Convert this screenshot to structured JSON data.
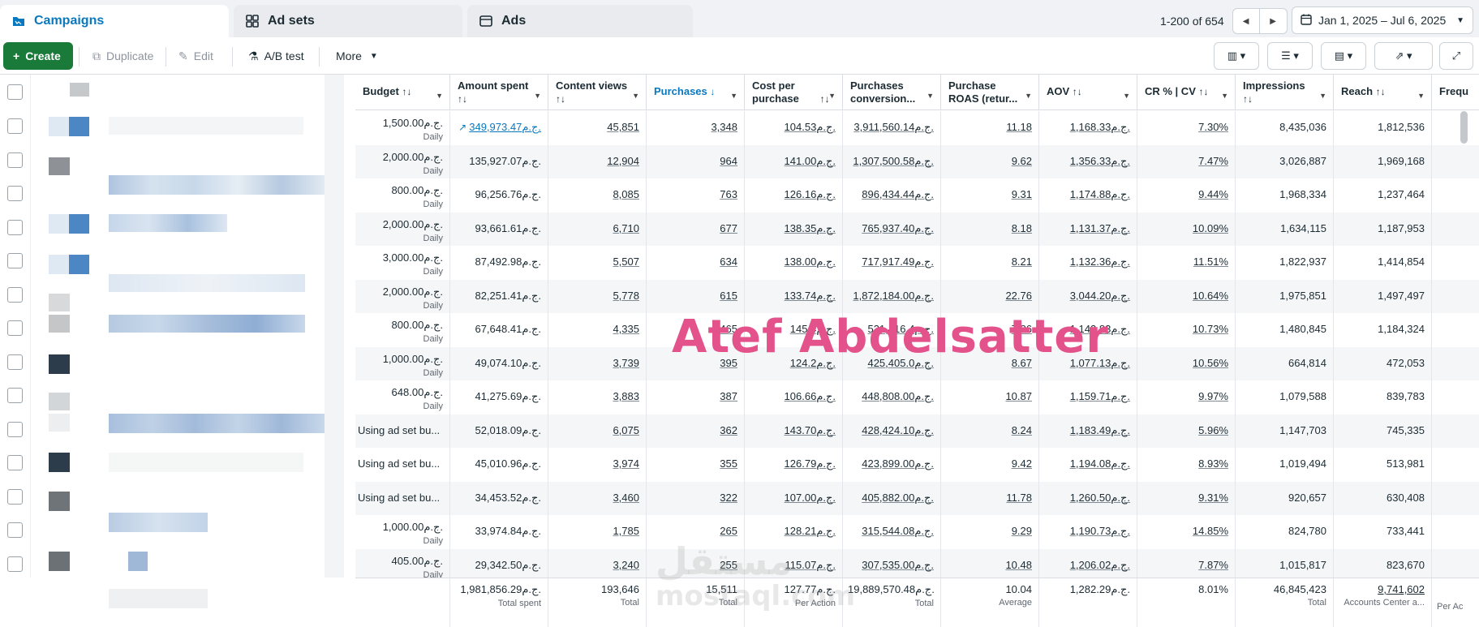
{
  "tabs": [
    {
      "label": "Campaigns",
      "icon": "folder-icon"
    },
    {
      "label": "Ad sets",
      "icon": "grid-icon"
    },
    {
      "label": "Ads",
      "icon": "ad-icon"
    }
  ],
  "pager": {
    "range": "1-200 of 654"
  },
  "date_range": "Jan 1, 2025 – Jul 6, 2025",
  "toolbar": {
    "create": "Create",
    "duplicate": "Duplicate",
    "edit": "Edit",
    "ab_test": "A/B test",
    "more": "More"
  },
  "columns": [
    {
      "label": "Budget",
      "sort": "↑↓"
    },
    {
      "label": "Amount spent",
      "sort": "↑↓"
    },
    {
      "label": "Content views",
      "sort": "↑↓"
    },
    {
      "label": "Purchases",
      "sort": "↓"
    },
    {
      "label": "Cost per purchase",
      "sort": "↑↓"
    },
    {
      "label": "Purchases conversion...",
      "sort": ""
    },
    {
      "label": "Purchase ROAS (retur...",
      "sort": ""
    },
    {
      "label": "AOV",
      "sort": "↑↓"
    },
    {
      "label": "CR % | CV",
      "sort": "↑↓"
    },
    {
      "label": "Impressions",
      "sort": "↑↓"
    },
    {
      "label": "Reach",
      "sort": "↑↓"
    },
    {
      "label": "Frequ",
      "sort": ""
    }
  ],
  "rows": [
    {
      "budget": "1,500.00ج.م.",
      "budget_sub": "Daily",
      "spent": "349,973.47ج.م.",
      "content_views": "45,851",
      "purchases": "3,348",
      "cpp": "104.53ج.م.",
      "conv_value": "3,911,560.14ج.م.",
      "roas": "11.18",
      "aov": "1,168.33ج.م.",
      "cr": "7.30%",
      "impressions": "8,435,036",
      "reach": "1,812,536"
    },
    {
      "budget": "2,000.00ج.م.",
      "budget_sub": "Daily",
      "spent": "135,927.07ج.م.",
      "content_views": "12,904",
      "purchases": "964",
      "cpp": "141.00ج.م.",
      "conv_value": "1,307,500.58ج.م.",
      "roas": "9.62",
      "aov": "1,356.33ج.م.",
      "cr": "7.47%",
      "impressions": "3,026,887",
      "reach": "1,969,168"
    },
    {
      "budget": "800.00ج.م.",
      "budget_sub": "Daily",
      "spent": "96,256.76ج.م.",
      "content_views": "8,085",
      "purchases": "763",
      "cpp": "126.16ج.م.",
      "conv_value": "896,434.44ج.م.",
      "roas": "9.31",
      "aov": "1,174.88ج.م.",
      "cr": "9.44%",
      "impressions": "1,968,334",
      "reach": "1,237,464"
    },
    {
      "budget": "2,000.00ج.م.",
      "budget_sub": "Daily",
      "spent": "93,661.61ج.م.",
      "content_views": "6,710",
      "purchases": "677",
      "cpp": "138.35ج.م.",
      "conv_value": "765,937.40ج.م.",
      "roas": "8.18",
      "aov": "1,131.37ج.م.",
      "cr": "10.09%",
      "impressions": "1,634,115",
      "reach": "1,187,953"
    },
    {
      "budget": "3,000.00ج.م.",
      "budget_sub": "Daily",
      "spent": "87,492.98ج.م.",
      "content_views": "5,507",
      "purchases": "634",
      "cpp": "138.00ج.م.",
      "conv_value": "717,917.49ج.م.",
      "roas": "8.21",
      "aov": "1,132.36ج.م.",
      "cr": "11.51%",
      "impressions": "1,822,937",
      "reach": "1,414,854"
    },
    {
      "budget": "2,000.00ج.م.",
      "budget_sub": "Daily",
      "spent": "82,251.41ج.م.",
      "content_views": "5,778",
      "purchases": "615",
      "cpp": "133.74ج.م.",
      "conv_value": "1,872,184.00ج.م.",
      "roas": "22.76",
      "aov": "3,044.20ج.م.",
      "cr": "10.64%",
      "impressions": "1,975,851",
      "reach": "1,497,497"
    },
    {
      "budget": "800.00ج.م.",
      "budget_sub": "Daily",
      "spent": "67,648.41ج.م.",
      "content_views": "4,335",
      "purchases": "465",
      "cpp": "145.4ج.م.",
      "conv_value": "531,416.4ج.م.",
      "roas": "7.86",
      "aov": "1,142.83ج.م.",
      "cr": "10.73%",
      "impressions": "1,480,845",
      "reach": "1,184,324"
    },
    {
      "budget": "1,000.00ج.م.",
      "budget_sub": "Daily",
      "spent": "49,074.10ج.م.",
      "content_views": "3,739",
      "purchases": "395",
      "cpp": "124.2ج.م.",
      "conv_value": "425,405.0ج.م.",
      "roas": "8.67",
      "aov": "1,077.13ج.م.",
      "cr": "10.56%",
      "impressions": "664,814",
      "reach": "472,053"
    },
    {
      "budget": "648.00ج.م.",
      "budget_sub": "Daily",
      "spent": "41,275.69ج.م.",
      "content_views": "3,883",
      "purchases": "387",
      "cpp": "106.66ج.م.",
      "conv_value": "448,808.00ج.م.",
      "roas": "10.87",
      "aov": "1,159.71ج.م.",
      "cr": "9.97%",
      "impressions": "1,079,588",
      "reach": "839,783"
    },
    {
      "budget": "Using ad set bu...",
      "budget_sub": "",
      "spent": "52,018.09ج.م.",
      "content_views": "6,075",
      "purchases": "362",
      "cpp": "143.70ج.م.",
      "conv_value": "428,424.10ج.م.",
      "roas": "8.24",
      "aov": "1,183.49ج.م.",
      "cr": "5.96%",
      "impressions": "1,147,703",
      "reach": "745,335"
    },
    {
      "budget": "Using ad set bu...",
      "budget_sub": "",
      "spent": "45,010.96ج.م.",
      "content_views": "3,974",
      "purchases": "355",
      "cpp": "126.79ج.م.",
      "conv_value": "423,899.00ج.م.",
      "roas": "9.42",
      "aov": "1,194.08ج.م.",
      "cr": "8.93%",
      "impressions": "1,019,494",
      "reach": "513,981"
    },
    {
      "budget": "Using ad set bu...",
      "budget_sub": "",
      "spent": "34,453.52ج.م.",
      "content_views": "3,460",
      "purchases": "322",
      "cpp": "107.00ج.م.",
      "conv_value": "405,882.00ج.م.",
      "roas": "11.78",
      "aov": "1,260.50ج.م.",
      "cr": "9.31%",
      "impressions": "920,657",
      "reach": "630,408"
    },
    {
      "budget": "1,000.00ج.م.",
      "budget_sub": "Daily",
      "spent": "33,974.84ج.م.",
      "content_views": "1,785",
      "purchases": "265",
      "cpp": "128.21ج.م.",
      "conv_value": "315,544.08ج.م.",
      "roas": "9.29",
      "aov": "1,190.73ج.م.",
      "cr": "14.85%",
      "impressions": "824,780",
      "reach": "733,441"
    },
    {
      "budget": "405.00ج.م.",
      "budget_sub": "Daily",
      "spent": "29,342.50ج.م.",
      "content_views": "3,240",
      "purchases": "255",
      "cpp": "115.07ج.م.",
      "conv_value": "307,535.00ج.م.",
      "roas": "10.48",
      "aov": "1,206.02ج.م.",
      "cr": "7.87%",
      "impressions": "1,015,817",
      "reach": "823,670"
    }
  ],
  "totals": {
    "spent": "1,981,856.29ج.م.",
    "spent_sub": "Total spent",
    "content_views": "193,646",
    "content_views_sub": "Total",
    "purchases": "15,511",
    "purchases_sub": "Total",
    "cpp": "127.77ج.م.",
    "cpp_sub": "Per Action",
    "conv_value": "19,889,570.48ج.م.",
    "conv_value_sub": "Total",
    "roas": "10.04",
    "roas_sub": "Average",
    "aov": "1,282.29ج.م.",
    "cr": "8.01%",
    "impressions": "46,845,423",
    "impressions_sub": "Total",
    "reach": "9,741,602",
    "reach_sub": "Accounts Center a...",
    "freq_sub": "Per Ac"
  },
  "watermark": "Atef Abdelsatter",
  "watermark_logo": "مستقل",
  "watermark_logo_sub": "mostaql.com",
  "colors": {
    "accent": "#0a78be",
    "create": "#1a7a3a",
    "watermark": "#e3528a"
  }
}
